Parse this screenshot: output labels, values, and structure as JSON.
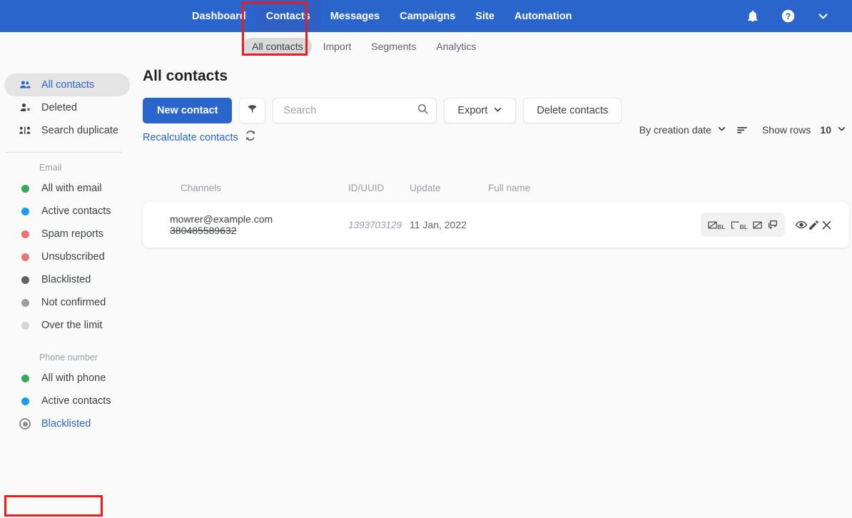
{
  "topnav": {
    "items": [
      {
        "label": "Dashboard",
        "active": false
      },
      {
        "label": "Contacts",
        "active": true
      },
      {
        "label": "Messages",
        "active": false
      },
      {
        "label": "Campaigns",
        "active": false
      },
      {
        "label": "Site",
        "active": false
      },
      {
        "label": "Automation",
        "active": false
      }
    ],
    "icons": [
      "bell-icon",
      "help-icon",
      "chevron-down-icon"
    ]
  },
  "subnav": {
    "items": [
      {
        "label": "All contacts",
        "active": true
      },
      {
        "label": "Import",
        "active": false
      },
      {
        "label": "Segments",
        "active": false
      },
      {
        "label": "Analytics",
        "active": false
      }
    ]
  },
  "sidebar": {
    "top_items": [
      {
        "label": "All contacts",
        "icon": "people-icon",
        "active": true
      },
      {
        "label": "Deleted",
        "icon": "person-remove-icon",
        "active": false
      },
      {
        "label": "Search duplicate",
        "icon": "duplicate-people-icon",
        "active": false
      }
    ],
    "email_group": {
      "label": "Email",
      "items": [
        {
          "label": "All with email",
          "color": "#34a853"
        },
        {
          "label": "Active contacts",
          "color": "#1a9df0"
        },
        {
          "label": "Spam reports",
          "color": "#f0726f"
        },
        {
          "label": "Unsubscribed",
          "color": "#f0726f"
        },
        {
          "label": "Blacklisted",
          "color": "#5f6368"
        },
        {
          "label": "Not confirmed",
          "color": "#9e9e9e"
        },
        {
          "label": "Over the limit",
          "color": "#d5d5d5"
        }
      ]
    },
    "phone_group": {
      "label": "Phone number",
      "items": [
        {
          "label": "All with phone",
          "color": "#34a853",
          "selected": false
        },
        {
          "label": "Active contacts",
          "color": "#1a9df0",
          "selected": false
        },
        {
          "label": "Blacklisted",
          "color": "#8e8e8e",
          "selected": true
        }
      ]
    }
  },
  "main": {
    "page_title": "All contacts",
    "new_contact_label": "New contact",
    "filter_icon": "funnel-icon",
    "search": {
      "value": "",
      "placeholder": "Search",
      "icon": "search-icon"
    },
    "export_label": "Export",
    "delete_label": "Delete contacts",
    "recalculate_label": "Recalculate contacts",
    "recalculate_icon": "refresh-icon",
    "sort_label": "By creation date",
    "sort_icon": "sort-lines-icon",
    "show_rows_label": "Show rows",
    "show_rows_value": "10"
  },
  "table": {
    "headers": [
      "Channels",
      "ID/UUID",
      "Update",
      "Full name"
    ],
    "rows": [
      {
        "email": "mowrer@example.com",
        "phone": "380485589632",
        "id": "1393703129",
        "update": "11 Jan, 2022",
        "full_name": "",
        "actions": [
          "email-blacklist-icon",
          "phone-blacklist-icon",
          "email-unsubscribe-icon",
          "chat-icon",
          "view-icon",
          "edit-icon",
          "delete-icon"
        ]
      }
    ]
  },
  "colors": {
    "brand_blue": "#2a65cc",
    "annotation_red": "#ee1c1c",
    "page_bg": "#fafafa"
  }
}
